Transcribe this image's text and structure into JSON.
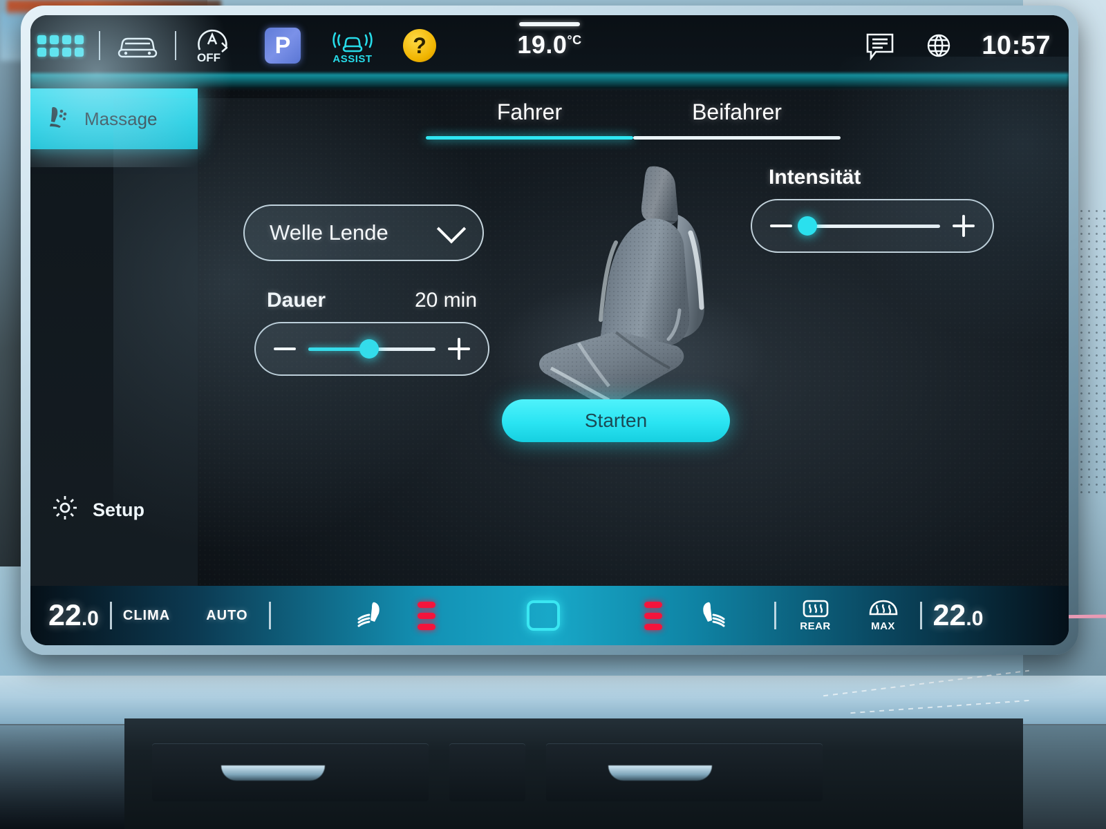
{
  "statusbar": {
    "apps_icon": "app-grid-icon",
    "car_icon": "car-front-icon",
    "auto_hold": {
      "icon": "auto-hold-icon",
      "label": "OFF"
    },
    "gear": {
      "label": "P",
      "name": "park-gear-badge"
    },
    "assist": {
      "icon": "travel-assist-icon",
      "label": "ASSIST"
    },
    "help": {
      "label": "?",
      "name": "help-badge"
    },
    "outside_temp": {
      "value": "19.0",
      "unit": "°C"
    },
    "message_icon": "message-icon",
    "globe_icon": "globe-icon",
    "clock": "10:57"
  },
  "sidebar": {
    "items": [
      {
        "label": "Massage",
        "icon": "seat-massage-icon",
        "active": true
      }
    ],
    "bottom": {
      "label": "Setup",
      "icon": "gear-icon"
    }
  },
  "main": {
    "tabs": [
      {
        "label": "Fahrer",
        "selected": true
      },
      {
        "label": "Beifahrer",
        "selected": false
      }
    ],
    "program_dropdown": {
      "value": "Welle Lende",
      "icon": "chevron-down-icon"
    },
    "duration": {
      "label": "Dauer",
      "value": "20 min",
      "percent": 48,
      "minus_icon": "minus-icon",
      "plus_icon": "plus-icon"
    },
    "intensity": {
      "label": "Intensität",
      "value": "",
      "percent": 2,
      "minus_icon": "minus-icon",
      "plus_icon": "plus-icon"
    },
    "start_button": "Starten",
    "seat_graphic": "driver-seat-3d-render"
  },
  "climate_bar": {
    "left_temp": {
      "whole": "22",
      "frac": ".0"
    },
    "clima_label": "CLIMA",
    "auto_label": "AUTO",
    "left_seat_heat_icon": "seat-heat-icon",
    "left_level_bars": 3,
    "center_square": "climate-screen-toggle",
    "right_level_bars": 3,
    "right_seat_heat_icon": "seat-heat-icon",
    "rear_defrost": {
      "label": "REAR",
      "icon": "rear-defrost-icon"
    },
    "max_defrost": {
      "label": "MAX",
      "icon": "max-defrost-icon"
    },
    "right_temp": {
      "whole": "22",
      "frac": ".0"
    }
  },
  "hardware_strip": {
    "power_icon": "power-icon",
    "volume_minus": "–",
    "volume_plus": "+",
    "left_cool_bar": "#5bb9e8",
    "left_warm_bar": "#e89ab4",
    "right_cool_bar": "#5bb9e8",
    "right_warm_bar": "#e89ab4"
  },
  "colors": {
    "accent_cyan": "#2ae4f2",
    "red_indicator": "#f4143c",
    "park_blue": "#6a85e0",
    "help_yellow": "#f0b400",
    "bezel_light": "#c9dfeb"
  }
}
